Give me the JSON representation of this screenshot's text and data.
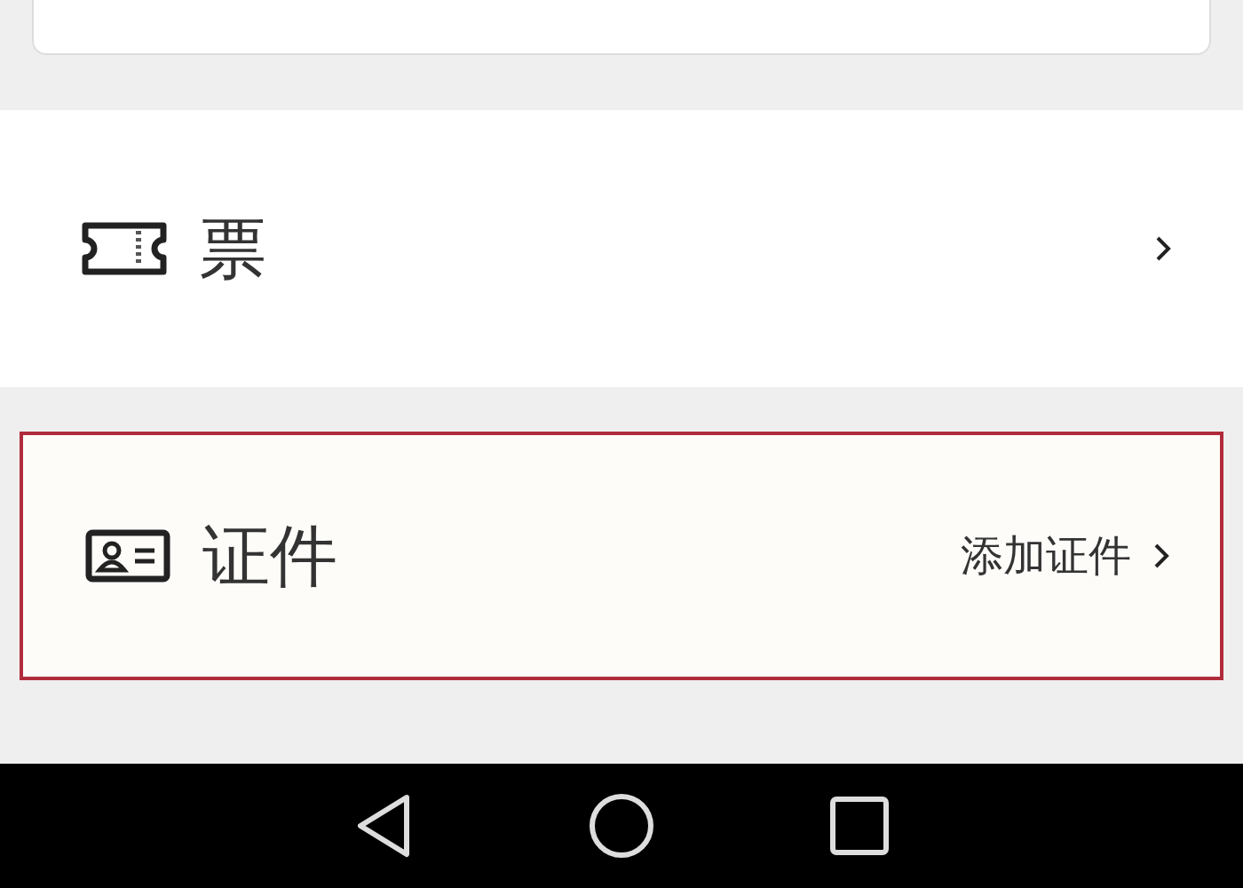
{
  "items": [
    {
      "kind": "ticket",
      "label": "票",
      "highlighted": false
    },
    {
      "kind": "id-card",
      "label": "证件",
      "hint": "添加证件",
      "highlighted": true
    }
  ]
}
